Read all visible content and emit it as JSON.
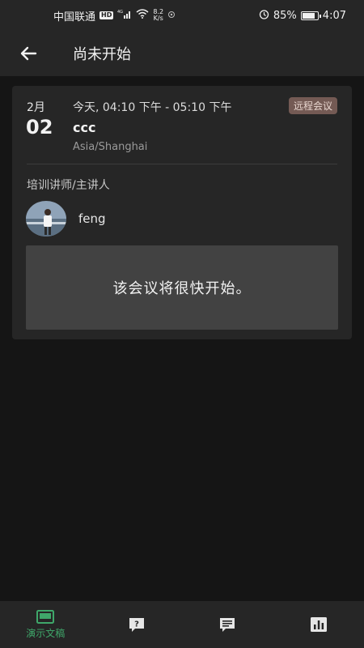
{
  "status_bar": {
    "carrier": "中国联通",
    "network": "4G",
    "speed_value": "8.2",
    "speed_unit": "K/s",
    "battery": "85%",
    "battery_level": 0.85,
    "time": "4:07"
  },
  "app_bar": {
    "title": "尚未开始"
  },
  "event": {
    "month": "2月",
    "day": "02",
    "time_range": "今天, 04:10 下午 - 05:10 下午",
    "name": "ccc",
    "timezone": "Asia/Shanghai",
    "badge": "远程会议",
    "speaker_label": "培训讲师/主讲人",
    "speaker_name": "feng",
    "notice": "该会议将很快开始。"
  },
  "bottom_nav": {
    "items": [
      {
        "label": "演示文稿",
        "icon": "presentation-icon",
        "active": true
      },
      {
        "label": "",
        "icon": "question-icon",
        "active": false
      },
      {
        "label": "",
        "icon": "chat-icon",
        "active": false
      },
      {
        "label": "",
        "icon": "stats-icon",
        "active": false
      }
    ]
  },
  "colors": {
    "background": "#151515",
    "surface": "#262626",
    "accent": "#3fa76a",
    "badge_bg": "#745a54"
  }
}
